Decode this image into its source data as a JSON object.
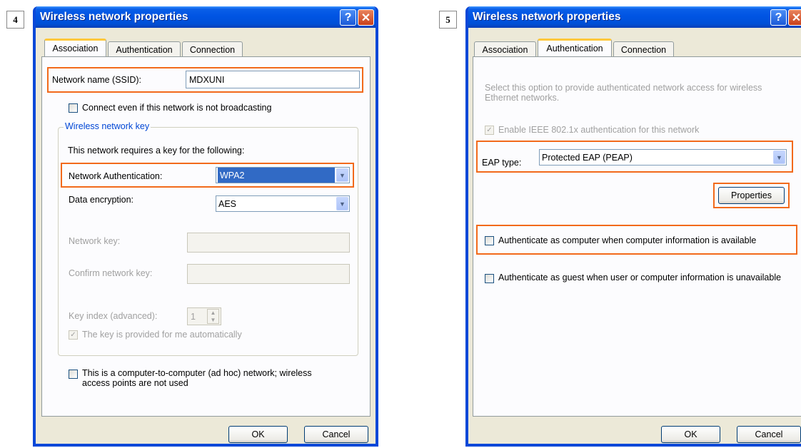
{
  "steps": [
    "4",
    "5"
  ],
  "dialog_left": {
    "title": "Wireless network properties",
    "help_label": "?",
    "close_label": "✕",
    "tabs": [
      "Association",
      "Authentication",
      "Connection"
    ],
    "ssid_label": "Network name (SSID):",
    "ssid_value": "MDXUNI",
    "connect_broadcast_label": "Connect even if this network is not broadcasting",
    "group_title": "Wireless network key",
    "requires_key_text": "This network requires a key for the following:",
    "auth_label": "Network Authentication:",
    "auth_value": "WPA2",
    "encryption_label": "Data encryption:",
    "encryption_value": "AES",
    "network_key_label": "Network key:",
    "confirm_key_label": "Confirm network key:",
    "key_index_label": "Key index (advanced):",
    "key_index_value": "1",
    "key_provided_label": "The key is provided for me automatically",
    "adhoc_label": "This is a computer-to-computer (ad hoc) network; wireless access points are not used",
    "ok_label": "OK",
    "cancel_label": "Cancel"
  },
  "dialog_right": {
    "title": "Wireless network properties",
    "help_label": "?",
    "close_label": "✕",
    "tabs": [
      "Association",
      "Authentication",
      "Connection"
    ],
    "intro_text": "Select this option to provide authenticated network access for wireless Ethernet networks.",
    "enable_8021x_label": "Enable IEEE 802.1x authentication for this network",
    "eap_label": "EAP type:",
    "eap_value": "Protected EAP (PEAP)",
    "properties_label": "Properties",
    "auth_computer_label": "Authenticate as computer when computer information is available",
    "auth_guest_label": "Authenticate as guest when user or computer information is unavailable",
    "ok_label": "OK",
    "cancel_label": "Cancel"
  },
  "colors": {
    "highlight": "#f26a1b",
    "titlebar": "#0054e3",
    "group_title": "#0046d5"
  }
}
